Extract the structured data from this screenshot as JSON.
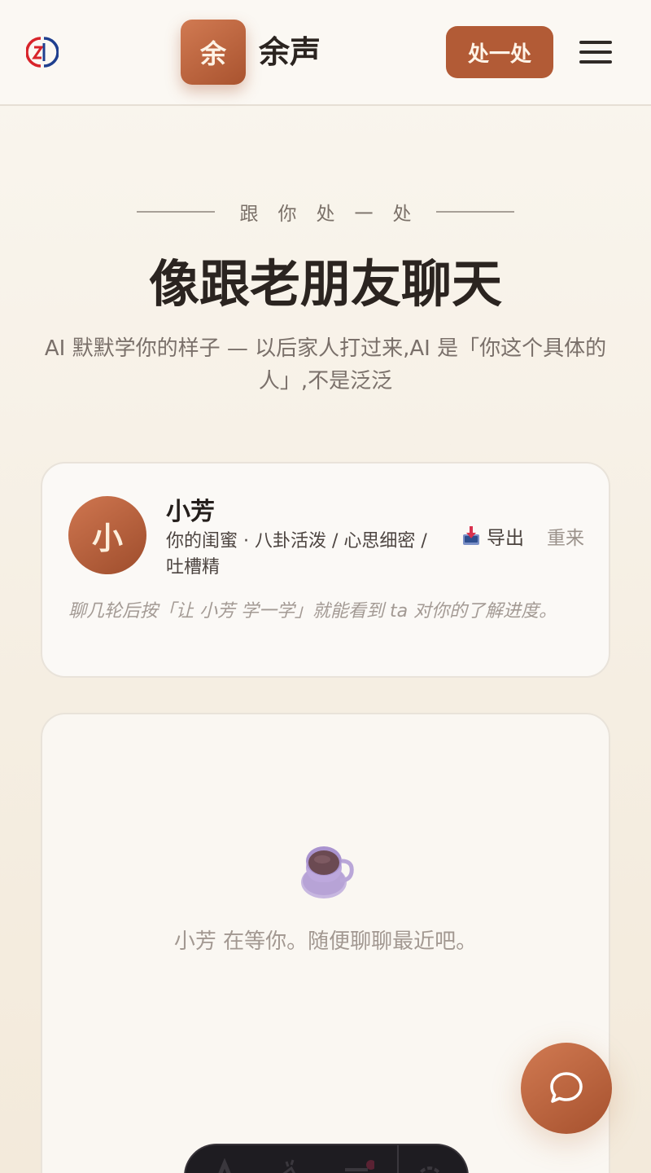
{
  "header": {
    "brand_logo": "ed-brand-logo",
    "app_badge_char": "余",
    "app_name": "余声",
    "cta_label": "处一处",
    "menu_icon": "hamburger-menu-icon"
  },
  "hero": {
    "eyebrow": "跟你处一处",
    "title": "像跟老朋友聊天",
    "subtitle": "AI 默默学你的样子 — 以后家人打过来,AI 是「你这个具体的人」,不是泛泛"
  },
  "persona": {
    "avatar_char": "小",
    "name": "小芳",
    "description": "你的闺蜜 · 八卦活泼 / 心思细密 / 吐槽精",
    "export_label": "导出",
    "export_icon": "inbox-tray-icon",
    "restart_label": "重来",
    "hint": "聊几轮后按「让 小芳 学一学」就能看到 ta 对你的了解进度。"
  },
  "chat": {
    "empty_icon": "teacup-icon",
    "empty_text": "小芳 在等你。随便聊聊最近吧。"
  },
  "fab": {
    "icon": "chat-bubble-icon"
  },
  "toolbar": {
    "tools": [
      "font-icon",
      "pen-icon",
      "list-icon",
      "settings-icon"
    ]
  },
  "colors": {
    "accent": "#b25b36",
    "background": "#f5eee2",
    "text": "#2b2420"
  }
}
